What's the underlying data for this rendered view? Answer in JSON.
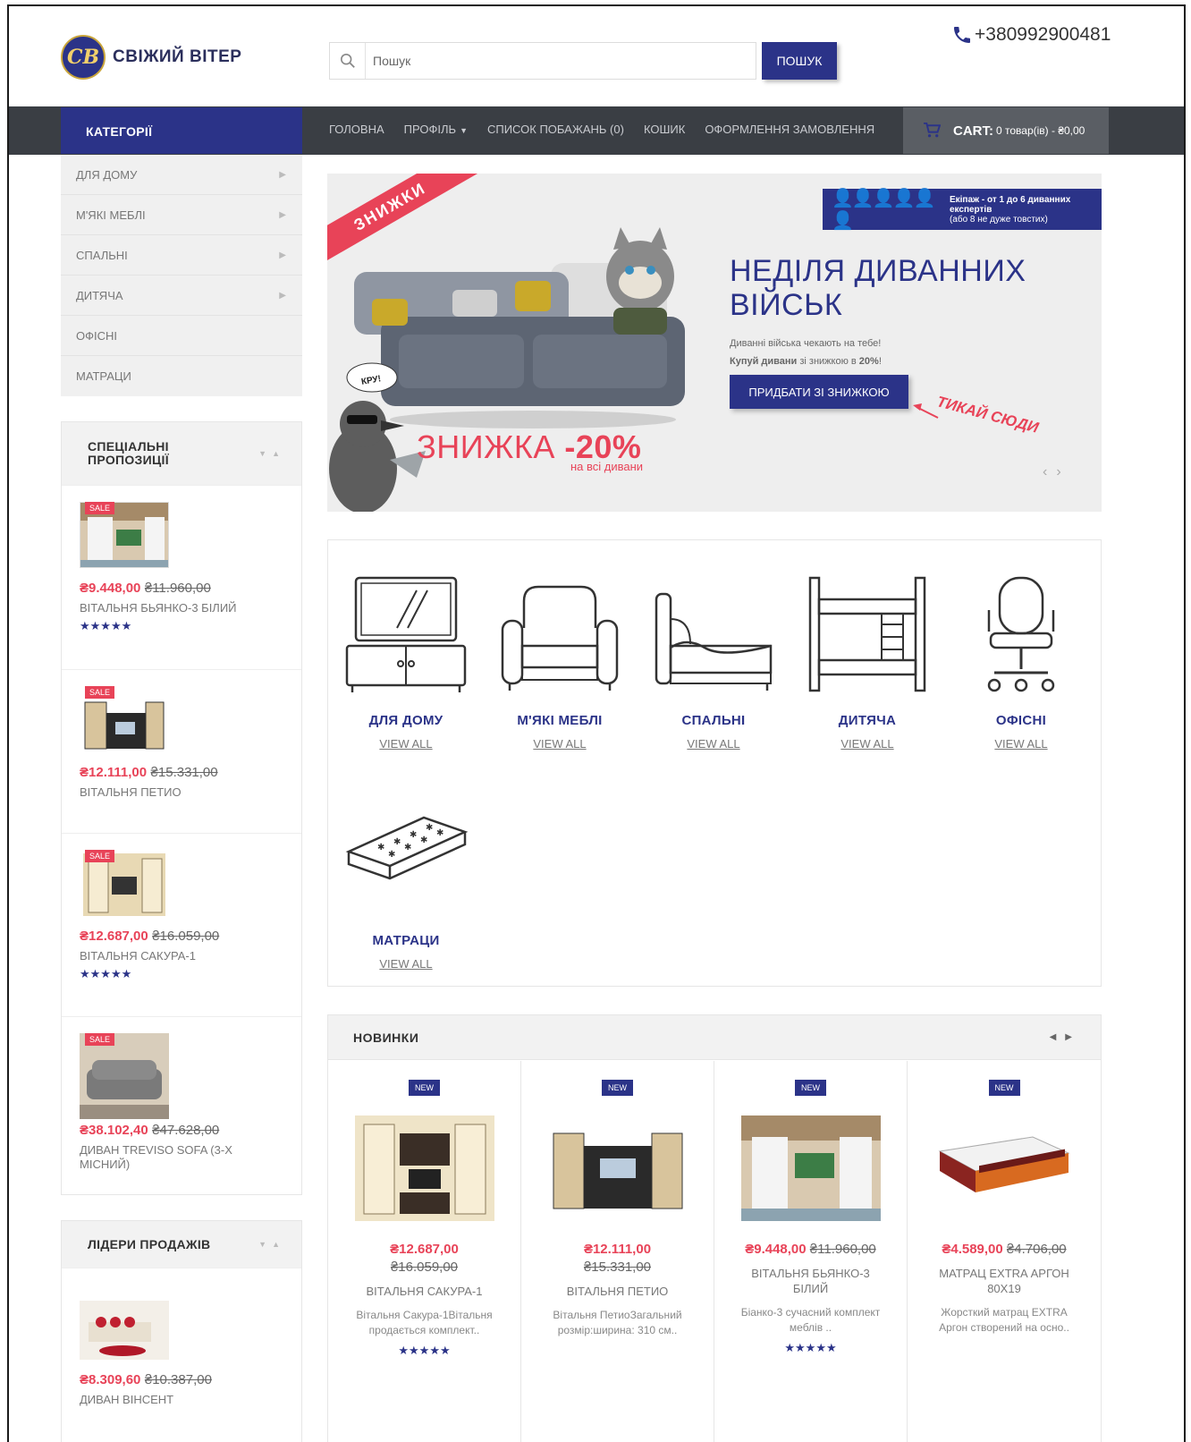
{
  "header": {
    "brand": "СВІЖИЙ ВІТЕР",
    "logo_letters": "СВ",
    "search_placeholder": "Пошук",
    "search_button": "ПОШУК",
    "phone": "+380992900481"
  },
  "nav": {
    "categories_title": "КАТЕГОРІЇ",
    "links": [
      "ГОЛОВНА",
      "ПРОФІЛЬ",
      "СПИСОК ПОБАЖАНЬ (0)",
      "КОШИК",
      "ОФОРМЛЕННЯ ЗАМОВЛЕННЯ"
    ],
    "cart_label": "CART:",
    "cart_value": "0 товар(ів) - ₴0,00"
  },
  "sidebar": {
    "categories": [
      "ДЛЯ ДОМУ",
      "М'ЯКІ МЕБЛІ",
      "СПАЛЬНІ",
      "ДИТЯЧА",
      "ОФІСНІ",
      "МАТРАЦИ"
    ],
    "specials_title_line1": "СПЕЦІАЛЬНІ",
    "specials_title_line2": "ПРОПОЗИЦІЇ",
    "sale_badge": "SALE",
    "specials": [
      {
        "price_new": "₴9.448,00",
        "price_old": "₴11.960,00",
        "name": "ВІТАЛЬНЯ БЬЯНКО-3 БІЛИЙ",
        "stars": "★★★★★"
      },
      {
        "price_new": "₴12.111,00",
        "price_old": "₴15.331,00",
        "name": "ВІТАЛЬНЯ ПЕТИО",
        "stars": ""
      },
      {
        "price_new": "₴12.687,00",
        "price_old": "₴16.059,00",
        "name": "ВІТАЛЬНЯ САКУРА-1",
        "stars": "★★★★★"
      },
      {
        "price_new": "₴38.102,40",
        "price_old": "₴47.628,00",
        "name": "ДИВАН TREVISO SOFA (3-Х МІСНИЙ)",
        "stars": ""
      }
    ],
    "bestsellers_title": "ЛІДЕРИ ПРОДАЖІВ",
    "bestsellers": [
      {
        "price_new": "₴8.309,60",
        "price_old": "₴10.387,00",
        "name": "ДИВАН ВІНСЕНТ"
      }
    ]
  },
  "banner": {
    "ribbon": "ЗНИЖКИ",
    "crew_bold": "Екіпаж - от 1 до 6 диванних експертів",
    "crew_small": "(або 8 не дуже товстих)",
    "title_line1": "НЕДІЛЯ ДИВАННИХ",
    "title_line2": "ВІЙСЬК",
    "text_line1": "Диванні війська чекають на тебе!",
    "text_bold": "Купуй дивани",
    "text_mid": " зі знижкою в ",
    "text_pct": "20%",
    "text_end": "!",
    "button": "ПРИДБАТИ ЗІ ЗНИЖКОЮ",
    "arrow_text": "ТИКАЙ СЮДИ",
    "bubble": "КРУ!",
    "discount_word": "ЗНИЖКА ",
    "discount_pct": "-20%",
    "discount_sub": "на всі дивани"
  },
  "categories": {
    "view_all": "VIEW ALL",
    "items": [
      "ДЛЯ ДОМУ",
      "М'ЯКІ МЕБЛІ",
      "СПАЛЬНІ",
      "ДИТЯЧА",
      "ОФІСНІ",
      "МАТРАЦИ"
    ]
  },
  "new_products": {
    "title": "НОВИНКИ",
    "badge": "NEW",
    "items": [
      {
        "price_new": "₴12.687,00",
        "price_old": "₴16.059,00",
        "name": "ВІТАЛЬНЯ САКУРА-1",
        "desc": "Вітальня Сакура-1Вітальня продається комплект..",
        "stars": "★★★★★"
      },
      {
        "price_new": "₴12.111,00",
        "price_old": "₴15.331,00",
        "name": "ВІТАЛЬНЯ ПЕТИО",
        "desc": "Вітальня ПетиоЗагальний розмір:ширина: 310 см..",
        "stars": ""
      },
      {
        "price_new": "₴9.448,00",
        "price_old": "₴11.960,00",
        "name": "ВІТАЛЬНЯ БЬЯНКО-3 БІЛИЙ",
        "desc": "Біанко-3 сучасний комплект меблів ..",
        "stars": "★★★★★"
      },
      {
        "price_new": "₴4.589,00",
        "price_old": "₴4.706,00",
        "name": "МАТРАЦ EXTRA АРГОН 80X19",
        "desc": "Жорсткий матрац EXTRA Аргон створений на осно..",
        "stars": ""
      }
    ]
  },
  "colors": {
    "brand": "#2b3388",
    "accent": "#e84358",
    "nav": "#3a3e44"
  }
}
